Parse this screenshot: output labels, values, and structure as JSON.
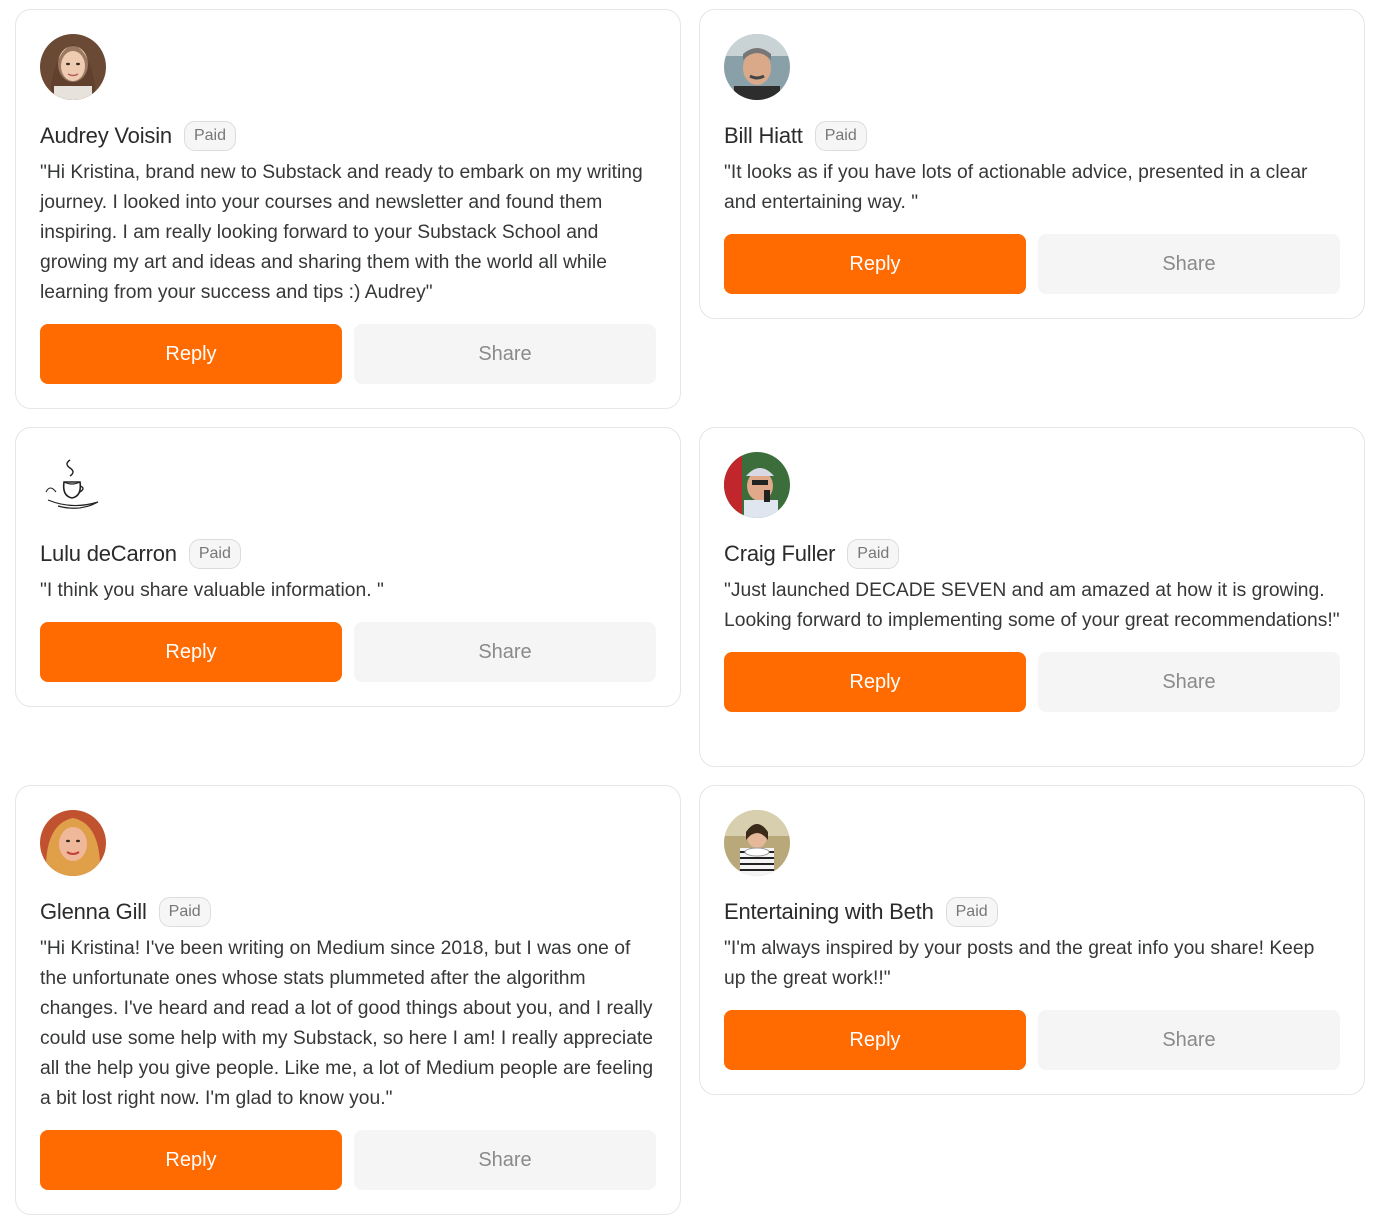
{
  "cards": [
    {
      "name": "Audrey Voisin",
      "badge": "Paid",
      "quote": "\"Hi Kristina, brand new to Substack and ready to embark on my writing journey. I looked into your courses and newsletter and found them inspiring. I am really looking forward to your Substack School and growing my art and ideas and sharing them with the world all while learning from your success and tips :) Audrey\"",
      "reply": "Reply",
      "share": "Share",
      "avatar": "profile-photo"
    },
    {
      "name": "Bill Hiatt",
      "badge": "Paid",
      "quote": "\"It looks as if you have lots of actionable advice, presented in a clear and entertaining way. \"",
      "reply": "Reply",
      "share": "Share",
      "avatar": "profile-photo"
    },
    {
      "name": "Lulu deCarron",
      "badge": "Paid",
      "quote": "\"I think you share valuable information. \"",
      "reply": "Reply",
      "share": "Share",
      "avatar": "coffee-cup-sketch-icon"
    },
    {
      "name": "Craig Fuller",
      "badge": "Paid",
      "quote": "\"Just launched DECADE SEVEN and am amazed at how it is growing. Looking forward to implementing some of your great recommendations!\"",
      "reply": "Reply",
      "share": "Share",
      "avatar": "profile-photo"
    },
    {
      "name": "Glenna Gill",
      "badge": "Paid",
      "quote": "\"Hi Kristina! I've been writing on Medium since 2018, but I was one of the unfortunate ones whose stats plummeted after the algorithm changes. I've heard and read a lot of good things about you, and I really could use some help with my Substack, so here I am! I really appreciate all the help you give people. Like me, a lot of Medium people are feeling a bit lost right now. I'm glad to know you.\"",
      "reply": "Reply",
      "share": "Share",
      "avatar": "profile-photo"
    },
    {
      "name": "Entertaining with Beth",
      "badge": "Paid",
      "quote": "\"I'm always inspired by your posts and the great info you share! Keep up the great work!!\"",
      "reply": "Reply",
      "share": "Share",
      "avatar": "profile-photo"
    }
  ],
  "colors": {
    "reply_bg": "#ff6b00",
    "share_bg": "#f5f5f5"
  }
}
